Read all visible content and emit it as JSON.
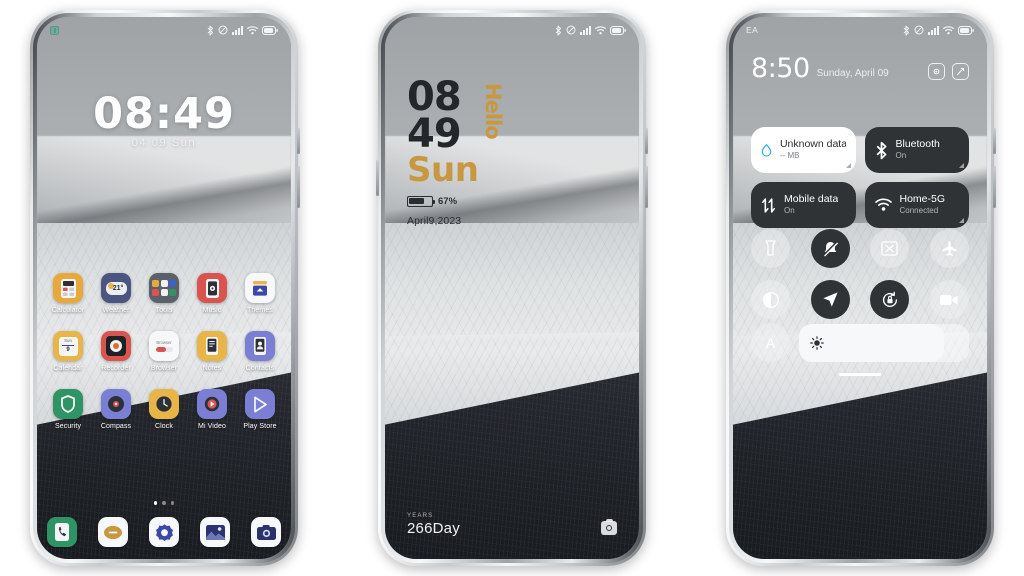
{
  "meta": {
    "background": "#ffffff",
    "accent_gold": "#c79840",
    "dark_tile": "#2f3335"
  },
  "phone1": {
    "name": "home-screen",
    "status_bar": {
      "badge_icon": "green-app-badge-icon",
      "icons": [
        "bluetooth-icon",
        "mute-icon",
        "signal-icon",
        "wifi-icon",
        "battery-icon"
      ]
    },
    "lockscreen": {
      "time": "08:49",
      "date": "04  09   Sun"
    },
    "app_rows": [
      [
        {
          "label": "Calculator",
          "icon": "calculator-icon",
          "bg": "#e8a93a",
          "fg": "#2c3037"
        },
        {
          "label": "Weather",
          "icon": "weather-icon",
          "bg": "#4a5580",
          "fg": "#ffffff",
          "text": "21°"
        },
        {
          "label": "Tools",
          "icon": "tools-folder-icon",
          "bg": "#5b6168",
          "fg": "#ffffff"
        },
        {
          "label": "Music",
          "icon": "music-icon",
          "bg": "#d9534f",
          "fg": "#ffffff"
        },
        {
          "label": "Themes",
          "icon": "themes-icon",
          "bg": "#f7f8f9",
          "fg": "#3b62c4"
        }
      ],
      [
        {
          "label": "Calendar",
          "icon": "calendar-icon",
          "bg": "#e8b648",
          "fg": "#2c3037",
          "text": "9"
        },
        {
          "label": "Recorder",
          "icon": "recorder-icon",
          "bg": "#d9534f",
          "fg": "#ffffff"
        },
        {
          "label": "Browser",
          "icon": "browser-icon",
          "bg": "#f7f8f9",
          "fg": "#d9534f"
        },
        {
          "label": "Notes",
          "icon": "notes-icon",
          "bg": "#e8b648",
          "fg": "#2c3037"
        },
        {
          "label": "Contacts",
          "icon": "contacts-icon",
          "bg": "#7a7fd4",
          "fg": "#2c3037"
        }
      ],
      [
        {
          "label": "Security",
          "icon": "security-shield-icon",
          "bg": "#2e9465",
          "fg": "#ffffff"
        },
        {
          "label": "Compass",
          "icon": "compass-icon",
          "bg": "#7a7fd4",
          "fg": "#2c3037"
        },
        {
          "label": "Clock",
          "icon": "clock-icon",
          "bg": "#e8b648",
          "fg": "#2c3037"
        },
        {
          "label": "Mi Video",
          "icon": "mi-video-icon",
          "bg": "#7a7fd4",
          "fg": "#d9534f"
        },
        {
          "label": "Play Store",
          "icon": "play-store-icon",
          "bg": "#7a7fd4",
          "fg": "#ffffff"
        }
      ]
    ],
    "page_dots": {
      "count": 3,
      "active": 0
    },
    "dock": [
      {
        "label": "Phone",
        "icon": "phone-icon",
        "bg": "#2e9465",
        "fg": "#ffffff"
      },
      {
        "label": "Messages",
        "icon": "messages-icon",
        "bg": "#f7f8f9",
        "fg": "#c79840"
      },
      {
        "label": "Settings",
        "icon": "settings-icon",
        "bg": "#f7f8f9",
        "fg": "#3b48a8"
      },
      {
        "label": "Gallery",
        "icon": "gallery-icon",
        "bg": "#f7f8f9",
        "fg": "#2b3270"
      },
      {
        "label": "Camera",
        "icon": "camera-icon",
        "bg": "#f7f8f9",
        "fg": "#2b3270"
      }
    ]
  },
  "phone2": {
    "name": "lock-screen-styled",
    "status_bar": {
      "icons": [
        "bluetooth-icon",
        "mute-icon",
        "signal-icon",
        "wifi-icon",
        "battery-icon"
      ]
    },
    "hours": "08",
    "minutes": "49",
    "weekday": "Sun",
    "greeting": "Hello",
    "battery_percent": "67%",
    "battery_level": 67,
    "date": "April9,2023",
    "footer_label": "YEARS",
    "footer_value": "266Day",
    "camera_shortcut_icon": "camera-icon"
  },
  "phone3": {
    "name": "control-center",
    "status_bar": {
      "carrier": "EA",
      "icons": [
        "bluetooth-icon",
        "mute-icon",
        "signal-icon",
        "wifi-icon",
        "battery-icon"
      ]
    },
    "time": "8:50",
    "date": "Sunday, April 09",
    "header_actions": [
      {
        "icon": "settings-gear-icon",
        "name": "settings-button"
      },
      {
        "icon": "edit-pencil-icon",
        "name": "edit-button"
      }
    ],
    "tiles": [
      {
        "title": "Unknown data plan",
        "subtitle": "-- MB",
        "icon": "data-drop-icon",
        "style": "light",
        "name": "data-plan-tile"
      },
      {
        "title": "Bluetooth",
        "subtitle": "On",
        "icon": "bluetooth-icon",
        "style": "dark",
        "name": "bluetooth-tile"
      },
      {
        "title": "Mobile data",
        "subtitle": "On",
        "icon": "mobile-data-icon",
        "style": "dark",
        "name": "mobile-data-tile"
      },
      {
        "title": "Home-5G",
        "subtitle": "Connected",
        "icon": "wifi-icon",
        "style": "dark",
        "name": "wifi-tile"
      }
    ],
    "toggles": [
      {
        "icon": "flashlight-icon",
        "name": "flashlight-toggle",
        "state": "off"
      },
      {
        "icon": "silent-mode-icon",
        "name": "silent-mode-toggle",
        "state": "on"
      },
      {
        "icon": "cast-icon",
        "name": "cast-toggle",
        "state": "off"
      },
      {
        "icon": "airplane-icon",
        "name": "airplane-mode-toggle",
        "state": "off"
      },
      {
        "icon": "dark-mode-icon",
        "name": "dark-mode-toggle",
        "state": "off"
      },
      {
        "icon": "location-icon",
        "name": "location-toggle",
        "state": "on"
      },
      {
        "icon": "rotation-lock-icon",
        "name": "rotation-lock-toggle",
        "state": "on"
      },
      {
        "icon": "screen-record-icon",
        "name": "screen-record-toggle",
        "state": "off"
      }
    ],
    "brightness": {
      "auto_label": "A",
      "icon": "brightness-sun-icon",
      "value": 85
    }
  }
}
